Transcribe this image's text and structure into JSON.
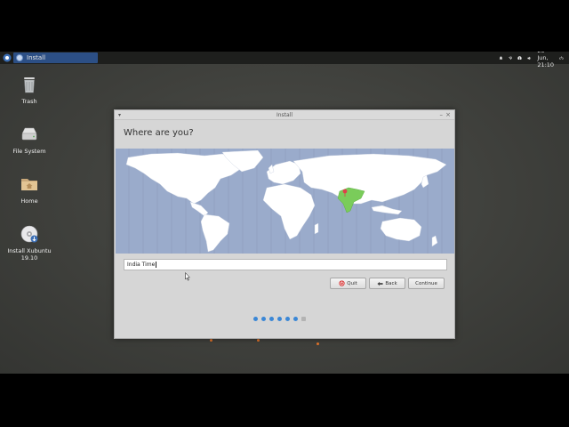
{
  "panel": {
    "app_menu_icon": "xubuntu-menu-icon",
    "task_label": "Install",
    "clock": "25 Jun, 21:10",
    "tray_icons": [
      "bell-icon",
      "wifi-icon",
      "info-icon",
      "volume-icon",
      "power-icon"
    ]
  },
  "desktop": {
    "icons": [
      {
        "label": "Trash",
        "icon": "trash-icon"
      },
      {
        "label": "File System",
        "icon": "drive-icon"
      },
      {
        "label": "Home",
        "icon": "folder-icon"
      },
      {
        "label": "Install Xubuntu",
        "label2": "19.10",
        "icon": "installer-cd-icon"
      }
    ]
  },
  "window": {
    "title": "Install",
    "heading": "Where are you?",
    "timezone_value": "India Time",
    "buttons": {
      "quit": "Quit",
      "back": "Back",
      "continue": "Continue"
    },
    "progress": {
      "completed_steps": 6,
      "total_steps": 7
    },
    "colors": {
      "map_ocean": "#9aabcb",
      "map_land": "#ffffff",
      "selected_region": "#7acc5a",
      "pin": "#e0404a",
      "progress_dot": "#3b87d6"
    }
  }
}
